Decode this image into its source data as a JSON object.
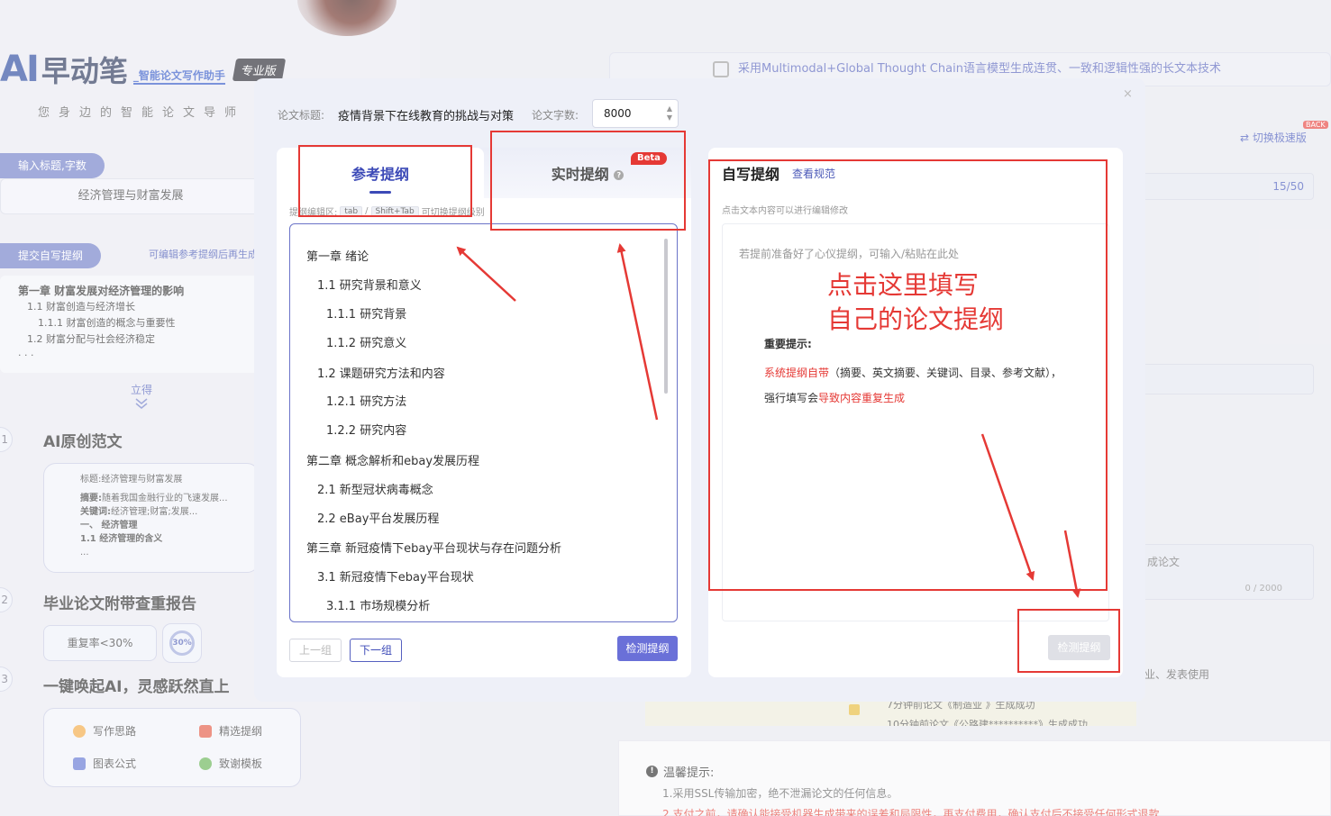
{
  "background": {
    "logo": {
      "ai": "AI",
      "name": "早动笔",
      "subtitle": "_智能论文写作助手",
      "pro": "专业版"
    },
    "slogan": "您身边的智能论文导师",
    "step1_label": "输入标题,字数",
    "title_value": "经济管理与财富发展",
    "step2_label": "提交自写提纲",
    "edit_hint": "可编辑参考提纲后再生成",
    "preview": [
      "第一章 财富发展对经济管理的影响",
      "1.1 财富创造与经济增长",
      "1.1.1 财富创造的概念与重要性",
      "1.2 财富分配与社会经济稳定",
      "· · ·"
    ],
    "lide": "立得",
    "steps": [
      "1",
      "2",
      "3"
    ],
    "sec1": "AI原创范文",
    "essay": {
      "title_label": "标题:",
      "title": "经济管理与财富发展",
      "abstract_label": "摘要:",
      "abstract": "随着我国金融行业的飞速发展...",
      "kw_label": "关键词:",
      "kw": "经济管理;财富;发展...",
      "l1": "一、 经济管理",
      "l2": "1.1 经济管理的含义",
      "l3": "..."
    },
    "sec2": "毕业论文附带查重报告",
    "dup_rate": "重复率<30%",
    "ring": "30%",
    "sec3": "一键唤起AI，灵感跃然直上",
    "tools": [
      "写作思路",
      "精选提纲",
      "图表公式",
      "致谢模板"
    ],
    "banner": "采用Multimodal+Global Thought Chain语言模型生成连贯、一致和逻辑性强的长文本技术",
    "switch": "切换极速版",
    "back": "BACK",
    "count": "15/50",
    "r3_text": "成论文",
    "r3_count": "0 / 2000",
    "r_text": "业、发表使用",
    "ticker1": "7分钟前论文《制造业          》生成成功",
    "ticker2": "10分钟前论文《公路建**********》生成成功",
    "tips_title": "温馨提示:",
    "tips_l1": "1.采用SSL传输加密，绝不泄漏论文的任何信息。",
    "tips_l2": "2.支付之前，请确认能接受机器生成带来的误差和局限性，再支付费用，确认支付后不接受任何形式退款"
  },
  "modal": {
    "title_label": "论文标题:",
    "title_value": "疫情背景下在线教育的挑战与对策",
    "words_label": "论文字数:",
    "words_value": "8000",
    "close": "×",
    "tabs": {
      "ref": "参考提纲",
      "live": "实时提纲",
      "beta": "Beta"
    },
    "kbd_hint": {
      "pre": "提纲编辑区:",
      "k1": "tab",
      "sep": "/",
      "k2": "Shift+Tab",
      "post": "可切换提纲级别"
    },
    "outline": [
      "第一章 绪论",
      "1.1 研究背景和意义",
      "1.1.1 研究背景",
      "1.1.2 研究意义",
      "1.2 课题研究方法和内容",
      "1.2.1 研究方法",
      "1.2.2 研究内容",
      "第二章 概念解析和ebay发展历程",
      "2.1 新型冠状病毒概念",
      "2.2 eBay平台发展历程",
      "第三章 新冠疫情下ebay平台现状与存在问题分析",
      "3.1 新冠疫情下ebay平台现状",
      "3.1.1 市场规模分析"
    ],
    "prev": "上一组",
    "next": "下一组",
    "check": "检测提纲",
    "self": {
      "title": "自写提纲",
      "link": "查看规范",
      "hint": "点击文本内容可以进行编辑修改",
      "placeholder": "若提前准备好了心仪提纲，可输入/粘贴在此处",
      "important": "重要提示:",
      "l1_red": "系统提纲自带",
      "l1_rest": "（摘要、英文摘要、关键词、目录、参考文献），",
      "l2_pre": "强行填写会",
      "l2_red": "导致内容重复生成",
      "check": "检测提纲"
    }
  },
  "annotation": {
    "line1": "点击这里填写",
    "line2": "自己的论文提纲",
    "color": "#e53935"
  }
}
